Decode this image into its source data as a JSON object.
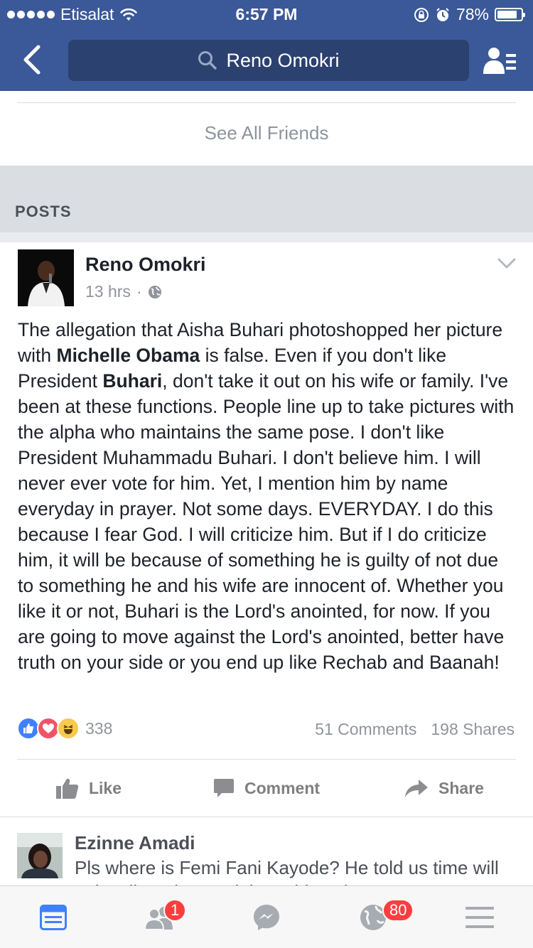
{
  "status_bar": {
    "carrier": "Etisalat",
    "time": "6:57 PM",
    "battery": "78%",
    "battery_level": 0.78
  },
  "nav": {
    "search_text": "Reno Omokri",
    "back_icon": "chevron-left-icon",
    "right_icon": "friend-list-icon"
  },
  "friends": {
    "see_all_label": "See All Friends"
  },
  "posts_section": {
    "header": "POSTS"
  },
  "post": {
    "author": "Reno Omokri",
    "time": "13 hrs",
    "separator": "·",
    "privacy_icon": "globe-icon",
    "text_parts": [
      "The allegation that Aisha Buhari photoshopped her picture with ",
      "Michelle Obama",
      " is false. Even if you don't like President ",
      "Buhari",
      ", don't take it out on his wife or family. I've been at these functions. People line up to take pictures with the alpha who maintains the same pose. I don't like President Muhammadu Buhari. I don't believe him. I will never ever vote for him. Yet, I mention him by name everyday in prayer. Not some days. EVERYDAY. I do this because I fear God. I will criticize him. But if I do criticize him, it will be because of something he is guilty of not due to something he and his wife are innocent of. Whether you like it or not, Buhari is the Lord's anointed, for now. If you are going to move against the Lord's anointed, better have truth on your side or you end up like Rechab and Baanah!"
    ],
    "reaction_count": "338",
    "comments": "51 Comments",
    "shares": "198 Shares",
    "actions": {
      "like": "Like",
      "comment": "Comment",
      "share": "Share"
    },
    "colors": {
      "like": "#4080ff",
      "love": "#f25268",
      "haha": "#f7c94c"
    }
  },
  "comment": {
    "author": "Ezinne Amadi",
    "text": "Pls where is Femi Fani Kayode? He told us time will only tell, and not quit long things have"
  },
  "tabbar": {
    "items": [
      {
        "icon": "news-feed-icon",
        "active": true
      },
      {
        "icon": "friend-requests-icon",
        "badge": "1"
      },
      {
        "icon": "messenger-icon"
      },
      {
        "icon": "notifications-globe-icon",
        "badge": "80"
      },
      {
        "icon": "menu-icon"
      }
    ]
  },
  "colors": {
    "brand": "#3b5998",
    "badge": "#fa3e3e"
  }
}
